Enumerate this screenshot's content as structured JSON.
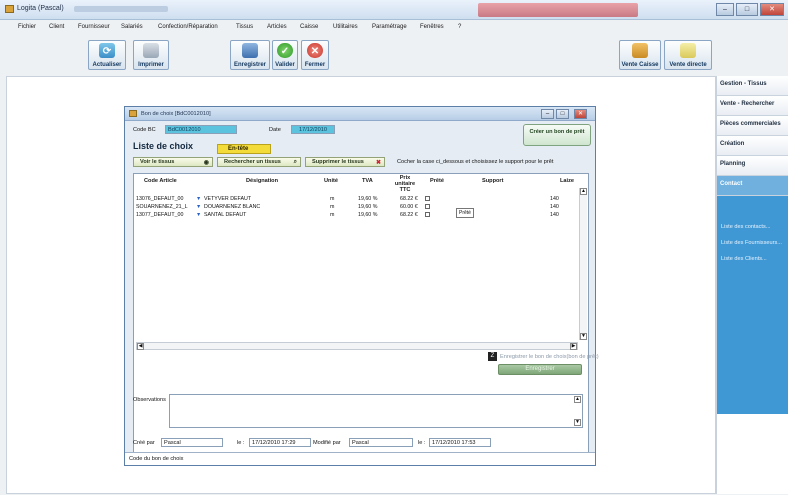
{
  "app": {
    "title": "Logita (Pascal)"
  },
  "window_controls": {
    "minimize": "–",
    "maximize": "□",
    "close": "✕"
  },
  "menu": [
    "Fichier",
    "Client",
    "Fournisseur",
    "Salariés",
    "Confection/Réparation",
    "Tissus",
    "Articles",
    "Caisse",
    "Utilitaires",
    "Paramétrage",
    "Fenêtres",
    "?"
  ],
  "toolbar": {
    "actualiser": "Actualiser",
    "imprimer": "Imprimer",
    "enregistrer": "Enregistrer",
    "valider": "Valider",
    "fermer": "Fermer",
    "vente_caisse": "Vente Caisse",
    "vente_directe": "Vente directe"
  },
  "right_panel": {
    "items": [
      "Gestion - Tissus",
      "Vente - Rechercher",
      "Pièces commerciales",
      "Création",
      "Planning"
    ],
    "active": "Contact",
    "links": [
      "Liste des contacts...",
      "Liste des Fournisseurs...",
      "Liste des Clients..."
    ]
  },
  "dialog": {
    "title": "Bon de choix [BdC0012010]",
    "code_label": "Code BC",
    "code_value": "BdC0012010",
    "date_label": "Date",
    "date_value": "17/12/2010",
    "create_loan_btn": "Créer un bon de prêt",
    "section_title": "Liste de choix",
    "tab_label": "En-tête",
    "btn_view": "Voir le tissus",
    "btn_search": "Rechercher un tissus",
    "btn_delete": "Supprimer le tissus",
    "hint": "Cocher la case ci_dessous et choisissez le support pour le prêt",
    "columns": [
      "Code Article",
      "Désignation",
      "Unité",
      "TVA",
      "Prix unitaire TTC",
      "Prêté",
      "Support",
      "Laize"
    ],
    "rows": [
      {
        "code": "13076_DEFAUT_00",
        "designation": "VETYVER DEFAUT",
        "unite": "m",
        "tva": "19,60 %",
        "prix": "68.22 €",
        "laize": "140"
      },
      {
        "code": "SOUARNENEZ_21_L",
        "designation": "DOUARNENEZ BLANC",
        "unite": "m",
        "tva": "19,60 %",
        "prix": "60.00 €",
        "laize": "140"
      },
      {
        "code": "13077_DEFAUT_00",
        "designation": "SANTAL DEFAUT",
        "unite": "m",
        "tva": "19,60 %",
        "prix": "68.22 €",
        "laize": "140"
      }
    ],
    "tooltip": "Prêté",
    "save_hint": "Enregistrer le bon de choix(bon de prêt)",
    "save_btn": "Enregistrer",
    "observations_label": "Observations",
    "created_by_label": "Créé par",
    "created_by": "Pascal",
    "on_label": "le :",
    "created_on": "17/12/2010 17:29",
    "modified_by_label": "Modifié par",
    "modified_by": "Pascal",
    "modified_on": "17/12/2010 17:53",
    "status": "Code du bon de choix"
  }
}
